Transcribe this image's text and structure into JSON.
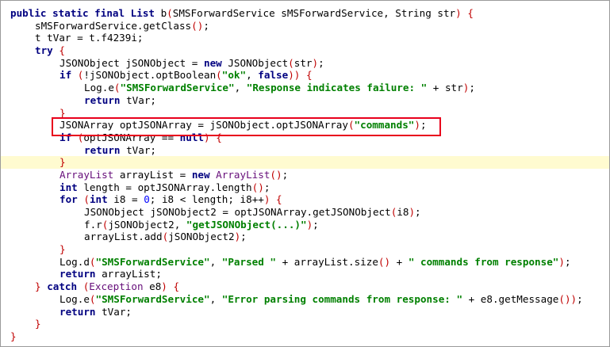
{
  "editor": {
    "lines": [
      {
        "indent": 0,
        "tokens": [
          [
            "k",
            "public static final "
          ],
          [
            "k",
            "List "
          ],
          [
            "p",
            "b"
          ],
          [
            "paren",
            "("
          ],
          [
            "p",
            "SMSForwardService sMSForwardService, String str"
          ],
          [
            "paren",
            ")"
          ],
          [
            "p",
            " "
          ],
          [
            "paren",
            "{"
          ]
        ]
      },
      {
        "indent": 1,
        "tokens": [
          [
            "p",
            "sMSForwardService.getClass"
          ],
          [
            "paren",
            "()"
          ],
          [
            "p",
            ";"
          ]
        ]
      },
      {
        "indent": 1,
        "tokens": [
          [
            "p",
            "t tVar = t.f4239i;"
          ]
        ]
      },
      {
        "indent": 1,
        "tokens": [
          [
            "k",
            "try "
          ],
          [
            "paren",
            "{"
          ]
        ]
      },
      {
        "indent": 2,
        "tokens": [
          [
            "p",
            "JSONObject jSONObject = "
          ],
          [
            "k",
            "new "
          ],
          [
            "p",
            "JSONObject"
          ],
          [
            "paren",
            "("
          ],
          [
            "p",
            "str"
          ],
          [
            "paren",
            ")"
          ],
          [
            "p",
            ";"
          ]
        ]
      },
      {
        "indent": 2,
        "tokens": [
          [
            "k",
            "if "
          ],
          [
            "paren",
            "("
          ],
          [
            "p",
            "!jSONObject.optBoolean"
          ],
          [
            "paren",
            "("
          ],
          [
            "s",
            "\"ok\""
          ],
          [
            "p",
            ", "
          ],
          [
            "k",
            "false"
          ],
          [
            "paren",
            "))"
          ],
          [
            "p",
            " "
          ],
          [
            "paren",
            "{"
          ]
        ]
      },
      {
        "indent": 3,
        "tokens": [
          [
            "p",
            "Log.e"
          ],
          [
            "paren",
            "("
          ],
          [
            "s",
            "\"SMSForwardService\""
          ],
          [
            "p",
            ", "
          ],
          [
            "s",
            "\"Response indicates failure: \""
          ],
          [
            "p",
            " + str"
          ],
          [
            "paren",
            ")"
          ],
          [
            "p",
            ";"
          ]
        ]
      },
      {
        "indent": 3,
        "tokens": [
          [
            "k",
            "return "
          ],
          [
            "p",
            "tVar;"
          ]
        ]
      },
      {
        "indent": 2,
        "tokens": [
          [
            "paren",
            "}"
          ]
        ]
      },
      {
        "indent": 2,
        "tokens": [
          [
            "p",
            "JSONArray optJSONArray = jSONObject.optJSONArray"
          ],
          [
            "paren",
            "("
          ],
          [
            "s",
            "\"commands\""
          ],
          [
            "paren",
            ")"
          ],
          [
            "p",
            ";"
          ]
        ]
      },
      {
        "indent": 2,
        "tokens": [
          [
            "k",
            "if "
          ],
          [
            "paren",
            "("
          ],
          [
            "p",
            "optJSONArray == "
          ],
          [
            "k",
            "null"
          ],
          [
            "paren",
            ")"
          ],
          [
            "p",
            " "
          ],
          [
            "paren",
            "{"
          ]
        ]
      },
      {
        "indent": 3,
        "tokens": [
          [
            "k",
            "return "
          ],
          [
            "p",
            "tVar;"
          ]
        ]
      },
      {
        "indent": 2,
        "highlight": true,
        "tokens": [
          [
            "paren",
            "}"
          ]
        ]
      },
      {
        "indent": 2,
        "tokens": [
          [
            "cls",
            "ArrayList "
          ],
          [
            "p",
            "arrayList = "
          ],
          [
            "k",
            "new "
          ],
          [
            "cls",
            "ArrayList"
          ],
          [
            "paren",
            "()"
          ],
          [
            "p",
            ";"
          ]
        ]
      },
      {
        "indent": 2,
        "tokens": [
          [
            "k",
            "int "
          ],
          [
            "p",
            "length = optJSONArray.length"
          ],
          [
            "paren",
            "()"
          ],
          [
            "p",
            ";"
          ]
        ]
      },
      {
        "indent": 2,
        "tokens": [
          [
            "k",
            "for "
          ],
          [
            "paren",
            "("
          ],
          [
            "k",
            "int "
          ],
          [
            "p",
            "i8 = "
          ],
          [
            "n",
            "0"
          ],
          [
            "p",
            "; i8 < length; i8++"
          ],
          [
            "paren",
            ")"
          ],
          [
            "p",
            " "
          ],
          [
            "paren",
            "{"
          ]
        ]
      },
      {
        "indent": 3,
        "tokens": [
          [
            "p",
            "JSONObject jSONObject2 = optJSONArray.getJSONObject"
          ],
          [
            "paren",
            "("
          ],
          [
            "p",
            "i8"
          ],
          [
            "paren",
            ")"
          ],
          [
            "p",
            ";"
          ]
        ]
      },
      {
        "indent": 3,
        "tokens": [
          [
            "p",
            "f.r"
          ],
          [
            "paren",
            "("
          ],
          [
            "p",
            "jSONObject2, "
          ],
          [
            "s",
            "\"getJSONObject(...)\""
          ],
          [
            "paren",
            ")"
          ],
          [
            "p",
            ";"
          ]
        ]
      },
      {
        "indent": 3,
        "tokens": [
          [
            "p",
            "arrayList.add"
          ],
          [
            "paren",
            "("
          ],
          [
            "p",
            "jSONObject2"
          ],
          [
            "paren",
            ")"
          ],
          [
            "p",
            ";"
          ]
        ]
      },
      {
        "indent": 2,
        "tokens": [
          [
            "paren",
            "}"
          ]
        ]
      },
      {
        "indent": 2,
        "tokens": [
          [
            "p",
            "Log.d"
          ],
          [
            "paren",
            "("
          ],
          [
            "s",
            "\"SMSForwardService\""
          ],
          [
            "p",
            ", "
          ],
          [
            "s",
            "\"Parsed \""
          ],
          [
            "p",
            " + arrayList.size"
          ],
          [
            "paren",
            "()"
          ],
          [
            "p",
            " + "
          ],
          [
            "s",
            "\" commands from response\""
          ],
          [
            "paren",
            ")"
          ],
          [
            "p",
            ";"
          ]
        ]
      },
      {
        "indent": 2,
        "tokens": [
          [
            "k",
            "return "
          ],
          [
            "p",
            "arrayList;"
          ]
        ]
      },
      {
        "indent": 1,
        "tokens": [
          [
            "paren",
            "}"
          ],
          [
            "p",
            " "
          ],
          [
            "k",
            "catch "
          ],
          [
            "paren",
            "("
          ],
          [
            "cls",
            "Exception "
          ],
          [
            "p",
            "e8"
          ],
          [
            "paren",
            ")"
          ],
          [
            "p",
            " "
          ],
          [
            "paren",
            "{"
          ]
        ]
      },
      {
        "indent": 2,
        "tokens": [
          [
            "p",
            "Log.e"
          ],
          [
            "paren",
            "("
          ],
          [
            "s",
            "\"SMSForwardService\""
          ],
          [
            "p",
            ", "
          ],
          [
            "s",
            "\"Error parsing commands from response: \""
          ],
          [
            "p",
            " + e8.getMessage"
          ],
          [
            "paren",
            "())"
          ],
          [
            "p",
            ";"
          ]
        ]
      },
      {
        "indent": 2,
        "tokens": [
          [
            "k",
            "return "
          ],
          [
            "p",
            "tVar;"
          ]
        ]
      },
      {
        "indent": 1,
        "tokens": [
          [
            "paren",
            "}"
          ]
        ]
      },
      {
        "indent": 0,
        "tokens": [
          [
            "paren",
            "}"
          ]
        ]
      }
    ]
  },
  "colors": {
    "keyword": "#000080",
    "string": "#008000",
    "bracket": "#c00000",
    "highlight_box": "#e8001c",
    "highlight_line": "#fffbd0"
  }
}
